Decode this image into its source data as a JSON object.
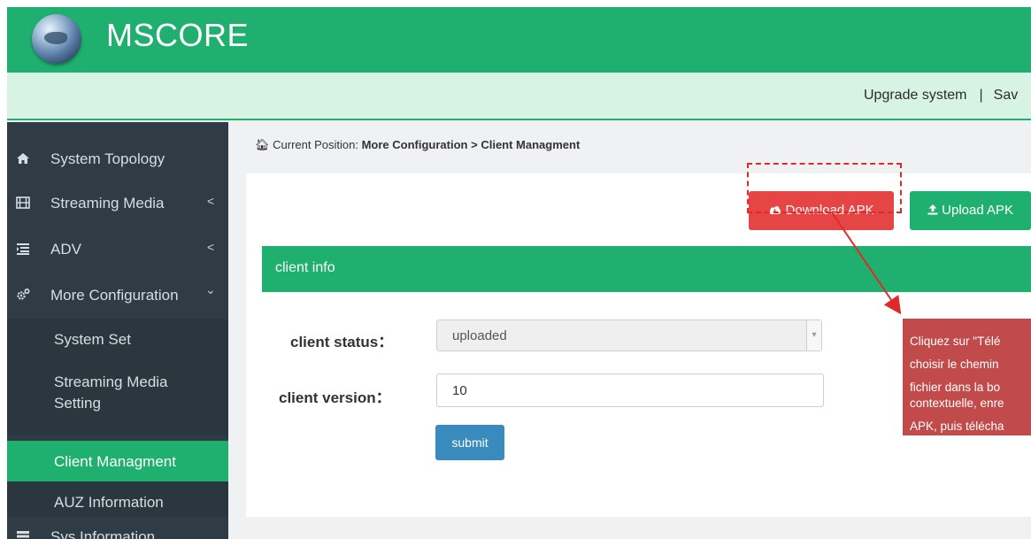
{
  "header": {
    "brand": "MSCORE",
    "links": [
      "Upgrade system",
      "Sav"
    ],
    "separator": "|"
  },
  "sidebar": {
    "items": [
      {
        "label": "System Topology",
        "icon": "home-icon"
      },
      {
        "label": "Streaming Media",
        "icon": "film-icon",
        "chevron": "<"
      },
      {
        "label": "ADV",
        "icon": "list-icon",
        "chevron": "<"
      },
      {
        "label": "More Configuration",
        "icon": "gears-icon",
        "chevron": "⌄"
      },
      {
        "label": "Sys Information",
        "icon": "server-icon"
      }
    ],
    "subitems": [
      {
        "label": "System Set"
      },
      {
        "label": "Streaming Media Setting"
      },
      {
        "label": "Client Managment",
        "active": true
      },
      {
        "label": "AUZ Information"
      }
    ]
  },
  "breadcrumb": {
    "prefix": "Current Position:",
    "section": "More Configuration",
    "sep": ">",
    "page": "Client Managment"
  },
  "toolbar": {
    "download_label": "Download APK",
    "upload_label": "Upload APK"
  },
  "panel": {
    "title": "client info",
    "status_label": "client status：",
    "status_value": "uploaded",
    "version_label": "client version：",
    "version_value": "10",
    "submit_label": "submit"
  },
  "callout": {
    "lines": [
      "Cliquez sur \"Télé",
      "choisir le chemin",
      "fichier dans la bo",
      "contextuelle, enre",
      "APK, puis télécha"
    ]
  },
  "colors": {
    "brand_green": "#1fb06f",
    "sidebar_bg": "#2f3c45",
    "download_red": "#e64545",
    "submit_blue": "#3a8bbd",
    "callout_red": "#c14a4b",
    "annotation_red": "#e02a2a"
  }
}
